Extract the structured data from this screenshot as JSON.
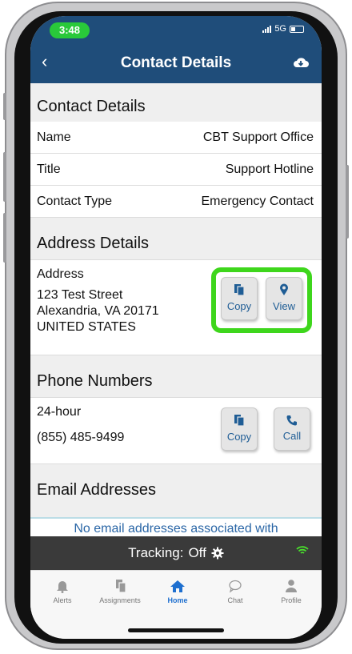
{
  "status": {
    "time": "3:48",
    "network": "5G"
  },
  "nav": {
    "title": "Contact Details"
  },
  "contact": {
    "section_title": "Contact Details",
    "rows": [
      {
        "label": "Name",
        "value": "CBT Support Office"
      },
      {
        "label": "Title",
        "value": "Support Hotline"
      },
      {
        "label": "Contact Type",
        "value": "Emergency Contact"
      }
    ]
  },
  "address": {
    "section_title": "Address Details",
    "label": "Address",
    "line1": "123 Test Street",
    "line2": "Alexandria, VA 20171",
    "line3": "UNITED STATES",
    "copy_label": "Copy",
    "view_label": "View"
  },
  "phone": {
    "section_title": "Phone Numbers",
    "label": "24-hour",
    "number": "(855) 485-9499",
    "copy_label": "Copy",
    "call_label": "Call"
  },
  "email": {
    "section_title": "Email Addresses",
    "empty_text": "No email addresses associated with"
  },
  "tracking": {
    "label": "Tracking:",
    "state": "Off"
  },
  "tabs": [
    {
      "label": "Alerts",
      "icon": "bell-icon"
    },
    {
      "label": "Assignments",
      "icon": "documents-icon"
    },
    {
      "label": "Home",
      "icon": "home-icon"
    },
    {
      "label": "Chat",
      "icon": "chat-icon"
    },
    {
      "label": "Profile",
      "icon": "user-icon"
    }
  ],
  "colors": {
    "header": "#1f4d7a",
    "accent": "#1f5d95",
    "highlight": "#3ed61c",
    "active_tab": "#1e6fcf"
  }
}
